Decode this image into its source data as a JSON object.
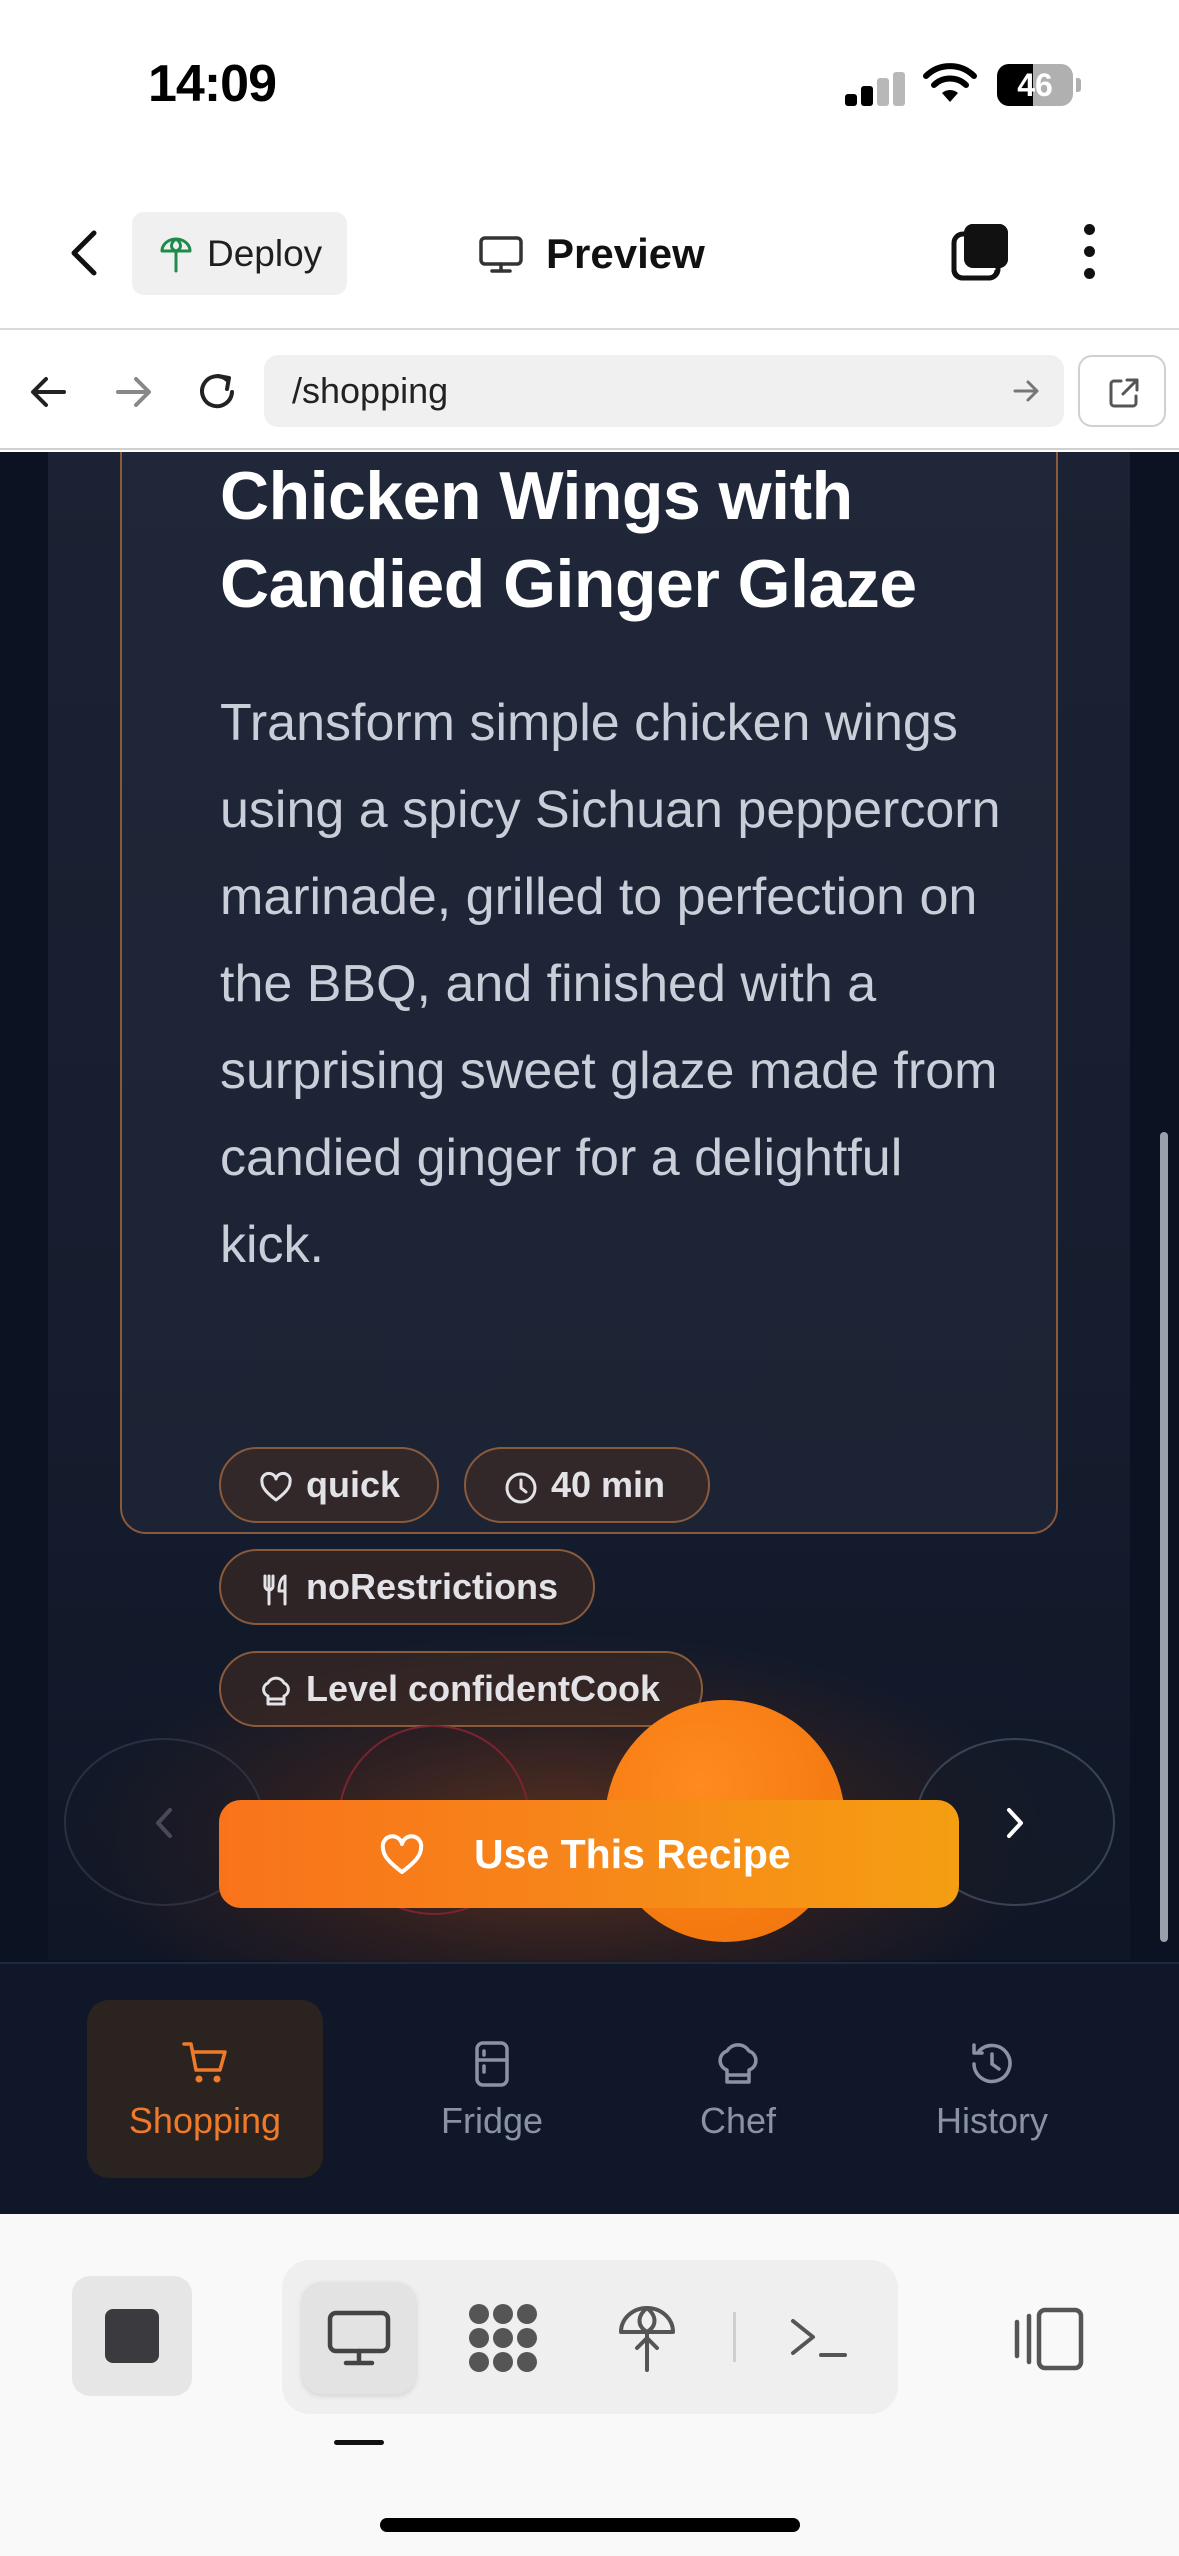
{
  "status_bar": {
    "time": "14:09",
    "battery": "46",
    "signal_icon": "cellular-signal-icon",
    "wifi_icon": "wifi-icon"
  },
  "header": {
    "back_icon": "chevron-left-icon",
    "deploy_label": "Deploy",
    "deploy_icon": "deploy-tree-icon",
    "preview_label": "Preview",
    "preview_icon": "monitor-icon",
    "tabs_icon": "tabs-stack-icon",
    "more_icon": "more-vertical-icon"
  },
  "url_bar": {
    "path": "/shopping",
    "back_icon": "arrow-left-icon",
    "forward_icon": "arrow-right-icon",
    "reload_icon": "reload-icon",
    "go_icon": "arrow-right-small-icon",
    "external_icon": "open-external-icon"
  },
  "recipe": {
    "title": "Chicken Wings with Candied Ginger Glaze",
    "description": "Transform simple chicken wings using a spicy Sichuan peppercorn marinade, grilled to perfection on the BBQ, and finished with a surprising sweet glaze made from candied ginger for a delightful kick.",
    "tags": [
      {
        "label": "quick",
        "icon": "heart-icon"
      },
      {
        "label": "40 min",
        "icon": "clock-icon"
      },
      {
        "label": "noRestrictions",
        "icon": "utensils-icon"
      },
      {
        "label": "Level confidentCook",
        "icon": "chef-hat-icon"
      }
    ],
    "use_button_label": "Use This Recipe",
    "use_button_icon": "heart-icon"
  },
  "carousel": {
    "prev_icon": "chevron-left-icon",
    "next_icon": "chevron-right-icon"
  },
  "tabbar": {
    "items": [
      {
        "label": "Shopping",
        "icon": "cart-icon",
        "active": true
      },
      {
        "label": "Fridge",
        "icon": "fridge-icon",
        "active": false
      },
      {
        "label": "Chef",
        "icon": "chef-hat-icon",
        "active": false
      },
      {
        "label": "History",
        "icon": "history-icon",
        "active": false
      }
    ]
  },
  "toolbar": {
    "stop_icon": "stop-icon",
    "tools": [
      "monitor-icon",
      "apps-grid-icon",
      "deploy-tree-icon",
      "terminal-icon"
    ],
    "panel_icon": "side-panel-icon"
  },
  "colors": {
    "accent": "#f97316",
    "dark_bg": "#0b1222",
    "card_border": "#8a5a3b"
  }
}
